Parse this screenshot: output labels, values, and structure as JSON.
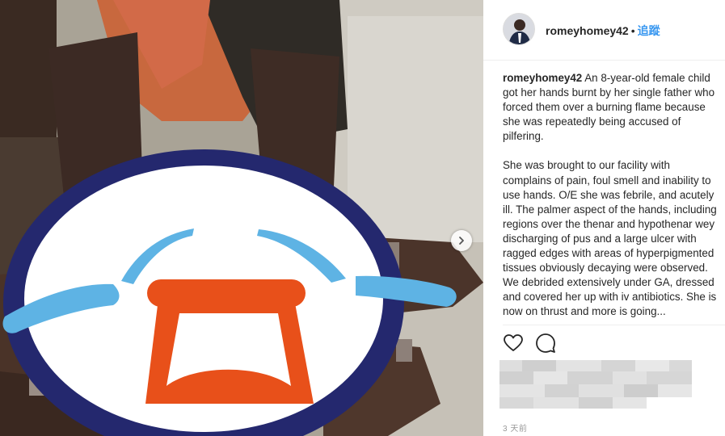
{
  "post": {
    "username": "romeyhomey42",
    "follow_label": "追蹤",
    "separator": "•",
    "caption_user": "romeyhomey42",
    "caption_p1": "An 8-year-old female child got her hands burnt by her single father who forced them over a burning flame because she was repeatedly being accused of pilfering.",
    "caption_p2": "She was brought to our facility with complains of pain, foul smell and inability to use hands. O/E she was febrile, and acutely ill. The palmer aspect of the hands, including regions over the thenar and hypothenar wey discharging of pus and a large ulcer with ragged edges with areas of hyperpigmented tissues obviously decaying were observed.",
    "caption_p3": "We debrided extensively under GA, dressed and covered her up with iv antibiotics. She is now on thrust and more is going...",
    "time_label": "3 天前"
  },
  "icons": {
    "like": "heart-icon",
    "comment": "comment-icon",
    "next": "chevron-right-icon",
    "overlay": "crying-face-emoji-sticker"
  },
  "colors": {
    "follow": "#3897f0",
    "emoji_ring": "#24286e",
    "emoji_mouth": "#e8501a",
    "emoji_tears": "#5eb3e4"
  }
}
